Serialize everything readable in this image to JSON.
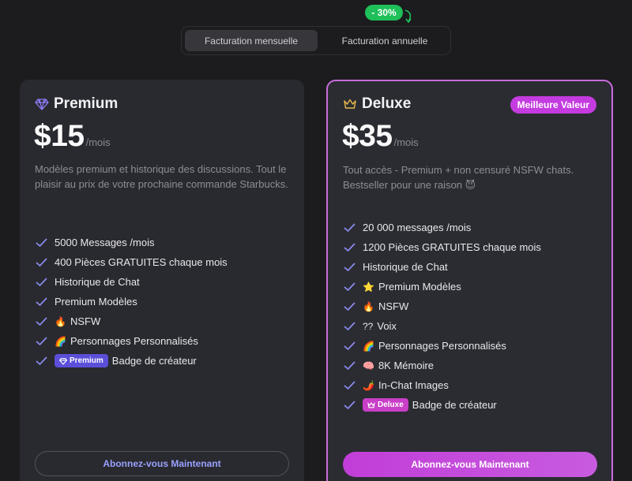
{
  "discount_badge": "- 30%",
  "billing": {
    "monthly": "Facturation mensuelle",
    "annual": "Facturation annuelle"
  },
  "premium": {
    "name": "Premium",
    "price": "$15",
    "unit": "/mois",
    "description": "Modèles premium et historique des discussions. Tout le plaisir au prix de votre prochaine commande Starbucks.",
    "features": [
      {
        "emoji": "",
        "text": "5000 Messages /mois"
      },
      {
        "emoji": "",
        "text": "400 Pièces GRATUITES chaque mois"
      },
      {
        "emoji": "",
        "text": "Historique de Chat"
      },
      {
        "emoji": "",
        "text": "Premium Modèles"
      },
      {
        "emoji": "🔥",
        "text": "NSFW"
      },
      {
        "emoji": "🌈",
        "text": "Personnages Personnalisés"
      }
    ],
    "badge_label": "Premium",
    "badge_text": "Badge de créateur",
    "cta": "Abonnez-vous Maintenant"
  },
  "deluxe": {
    "name": "Deluxe",
    "best_value": "Meilleure Valeur",
    "price": "$35",
    "unit": "/mois",
    "description": "Tout accès - Premium + non censuré NSFW chats. Bestseller pour une raison 😈",
    "features": [
      {
        "emoji": "",
        "text": "20 000 messages /mois"
      },
      {
        "emoji": "",
        "text": "1200 Pièces GRATUITES chaque mois"
      },
      {
        "emoji": "",
        "text": "Historique de Chat"
      },
      {
        "emoji": "⭐",
        "text": "Premium Modèles"
      },
      {
        "emoji": "🔥",
        "text": "NSFW"
      },
      {
        "emoji": "??",
        "text": "Voix"
      },
      {
        "emoji": "🌈",
        "text": "Personnages Personnalisés"
      },
      {
        "emoji": "🧠",
        "text": "8K Mémoire"
      },
      {
        "emoji": "🌶️",
        "text": "In-Chat Images"
      }
    ],
    "badge_label": "Deluxe",
    "badge_text": "Badge de créateur",
    "cta": "Abonnez-vous Maintenant"
  },
  "colors": {
    "accent": "#c43be0",
    "check": "#8b8cf0",
    "discount": "#1fbf5a"
  }
}
